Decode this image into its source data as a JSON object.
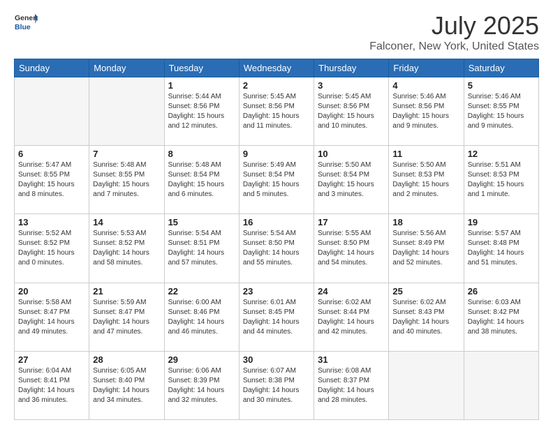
{
  "header": {
    "logo_general": "General",
    "logo_blue": "Blue",
    "title": "July 2025",
    "subtitle": "Falconer, New York, United States"
  },
  "days_of_week": [
    "Sunday",
    "Monday",
    "Tuesday",
    "Wednesday",
    "Thursday",
    "Friday",
    "Saturday"
  ],
  "weeks": [
    [
      {
        "day": "",
        "info": ""
      },
      {
        "day": "",
        "info": ""
      },
      {
        "day": "1",
        "info": "Sunrise: 5:44 AM\nSunset: 8:56 PM\nDaylight: 15 hours\nand 12 minutes."
      },
      {
        "day": "2",
        "info": "Sunrise: 5:45 AM\nSunset: 8:56 PM\nDaylight: 15 hours\nand 11 minutes."
      },
      {
        "day": "3",
        "info": "Sunrise: 5:45 AM\nSunset: 8:56 PM\nDaylight: 15 hours\nand 10 minutes."
      },
      {
        "day": "4",
        "info": "Sunrise: 5:46 AM\nSunset: 8:56 PM\nDaylight: 15 hours\nand 9 minutes."
      },
      {
        "day": "5",
        "info": "Sunrise: 5:46 AM\nSunset: 8:55 PM\nDaylight: 15 hours\nand 9 minutes."
      }
    ],
    [
      {
        "day": "6",
        "info": "Sunrise: 5:47 AM\nSunset: 8:55 PM\nDaylight: 15 hours\nand 8 minutes."
      },
      {
        "day": "7",
        "info": "Sunrise: 5:48 AM\nSunset: 8:55 PM\nDaylight: 15 hours\nand 7 minutes."
      },
      {
        "day": "8",
        "info": "Sunrise: 5:48 AM\nSunset: 8:54 PM\nDaylight: 15 hours\nand 6 minutes."
      },
      {
        "day": "9",
        "info": "Sunrise: 5:49 AM\nSunset: 8:54 PM\nDaylight: 15 hours\nand 5 minutes."
      },
      {
        "day": "10",
        "info": "Sunrise: 5:50 AM\nSunset: 8:54 PM\nDaylight: 15 hours\nand 3 minutes."
      },
      {
        "day": "11",
        "info": "Sunrise: 5:50 AM\nSunset: 8:53 PM\nDaylight: 15 hours\nand 2 minutes."
      },
      {
        "day": "12",
        "info": "Sunrise: 5:51 AM\nSunset: 8:53 PM\nDaylight: 15 hours\nand 1 minute."
      }
    ],
    [
      {
        "day": "13",
        "info": "Sunrise: 5:52 AM\nSunset: 8:52 PM\nDaylight: 15 hours\nand 0 minutes."
      },
      {
        "day": "14",
        "info": "Sunrise: 5:53 AM\nSunset: 8:52 PM\nDaylight: 14 hours\nand 58 minutes."
      },
      {
        "day": "15",
        "info": "Sunrise: 5:54 AM\nSunset: 8:51 PM\nDaylight: 14 hours\nand 57 minutes."
      },
      {
        "day": "16",
        "info": "Sunrise: 5:54 AM\nSunset: 8:50 PM\nDaylight: 14 hours\nand 55 minutes."
      },
      {
        "day": "17",
        "info": "Sunrise: 5:55 AM\nSunset: 8:50 PM\nDaylight: 14 hours\nand 54 minutes."
      },
      {
        "day": "18",
        "info": "Sunrise: 5:56 AM\nSunset: 8:49 PM\nDaylight: 14 hours\nand 52 minutes."
      },
      {
        "day": "19",
        "info": "Sunrise: 5:57 AM\nSunset: 8:48 PM\nDaylight: 14 hours\nand 51 minutes."
      }
    ],
    [
      {
        "day": "20",
        "info": "Sunrise: 5:58 AM\nSunset: 8:47 PM\nDaylight: 14 hours\nand 49 minutes."
      },
      {
        "day": "21",
        "info": "Sunrise: 5:59 AM\nSunset: 8:47 PM\nDaylight: 14 hours\nand 47 minutes."
      },
      {
        "day": "22",
        "info": "Sunrise: 6:00 AM\nSunset: 8:46 PM\nDaylight: 14 hours\nand 46 minutes."
      },
      {
        "day": "23",
        "info": "Sunrise: 6:01 AM\nSunset: 8:45 PM\nDaylight: 14 hours\nand 44 minutes."
      },
      {
        "day": "24",
        "info": "Sunrise: 6:02 AM\nSunset: 8:44 PM\nDaylight: 14 hours\nand 42 minutes."
      },
      {
        "day": "25",
        "info": "Sunrise: 6:02 AM\nSunset: 8:43 PM\nDaylight: 14 hours\nand 40 minutes."
      },
      {
        "day": "26",
        "info": "Sunrise: 6:03 AM\nSunset: 8:42 PM\nDaylight: 14 hours\nand 38 minutes."
      }
    ],
    [
      {
        "day": "27",
        "info": "Sunrise: 6:04 AM\nSunset: 8:41 PM\nDaylight: 14 hours\nand 36 minutes."
      },
      {
        "day": "28",
        "info": "Sunrise: 6:05 AM\nSunset: 8:40 PM\nDaylight: 14 hours\nand 34 minutes."
      },
      {
        "day": "29",
        "info": "Sunrise: 6:06 AM\nSunset: 8:39 PM\nDaylight: 14 hours\nand 32 minutes."
      },
      {
        "day": "30",
        "info": "Sunrise: 6:07 AM\nSunset: 8:38 PM\nDaylight: 14 hours\nand 30 minutes."
      },
      {
        "day": "31",
        "info": "Sunrise: 6:08 AM\nSunset: 8:37 PM\nDaylight: 14 hours\nand 28 minutes."
      },
      {
        "day": "",
        "info": ""
      },
      {
        "day": "",
        "info": ""
      }
    ]
  ]
}
